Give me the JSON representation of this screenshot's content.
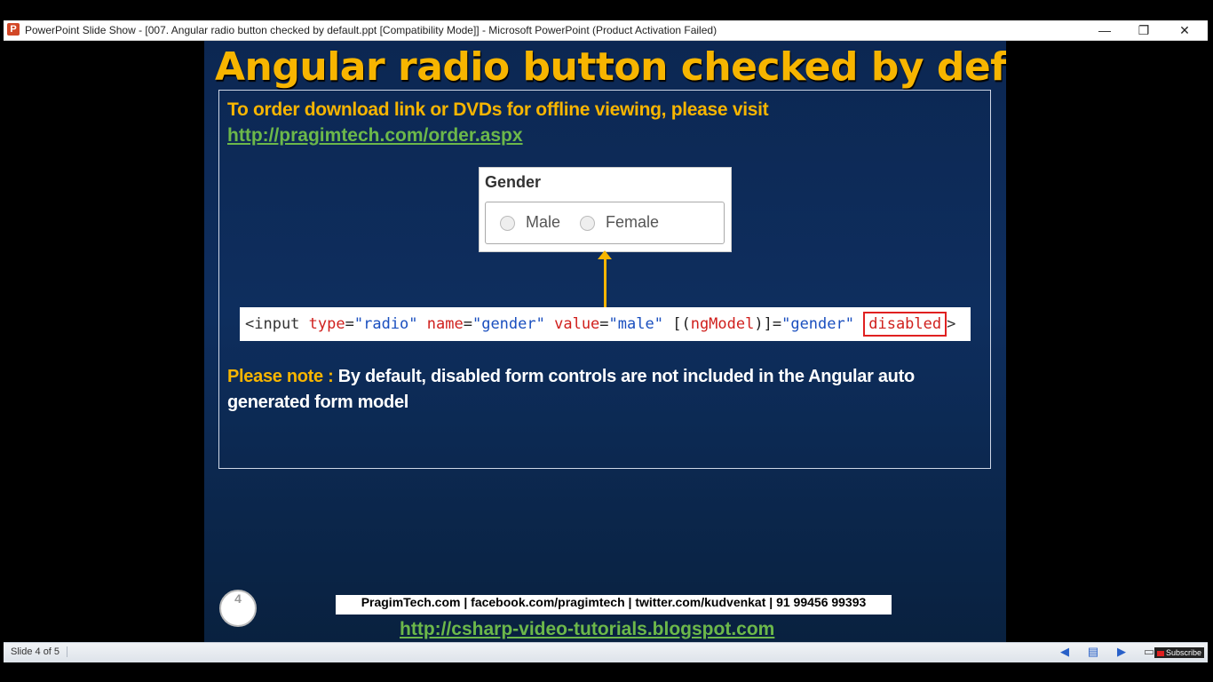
{
  "window": {
    "title": "PowerPoint Slide Show - [007. Angular radio button checked by default.ppt [Compatibility Mode]] - Microsoft PowerPoint (Product Activation Failed)",
    "app_icon": "P",
    "minimize": "—",
    "maximize": "❐",
    "close": "✕"
  },
  "slide": {
    "title": "Angular radio button checked by default",
    "order_text": "To order download link or DVDs for offline viewing, please visit",
    "order_link": "http://pragimtech.com/order.aspx",
    "gender_panel": {
      "label": "Gender",
      "options": [
        "Male",
        "Female"
      ]
    },
    "code": {
      "open": "<input ",
      "attr_type": "type",
      "eq": "=",
      "val_type": "\"radio\"",
      "attr_name": "name",
      "val_name": "\"gender\"",
      "attr_value": "value",
      "val_value": "\"male\"",
      "bind_open": "[(",
      "bind_attr": "ngModel",
      "bind_close": ")]",
      "val_model": "\"gender\"",
      "disabled": "disabled",
      "close": ">"
    },
    "note_label": "Please note :",
    "note_text": "By default, disabled form controls are not included in the Angular auto generated form model",
    "slide_number": "4",
    "footer": "PragimTech.com | facebook.com/pragimtech | twitter.com/kudvenkat | 91 99456 99393",
    "blog_link": "http://csharp-video-tutorials.blogspot.com"
  },
  "statusbar": {
    "slide_indicator": "Slide 4 of 5",
    "subscribe": "Subscribe"
  },
  "colors": {
    "title": "#f7b500",
    "link": "#6cb84a",
    "slide_bg": "#0e2e5e",
    "code_attr": "#d0201d",
    "code_value": "#1a4fbf"
  }
}
